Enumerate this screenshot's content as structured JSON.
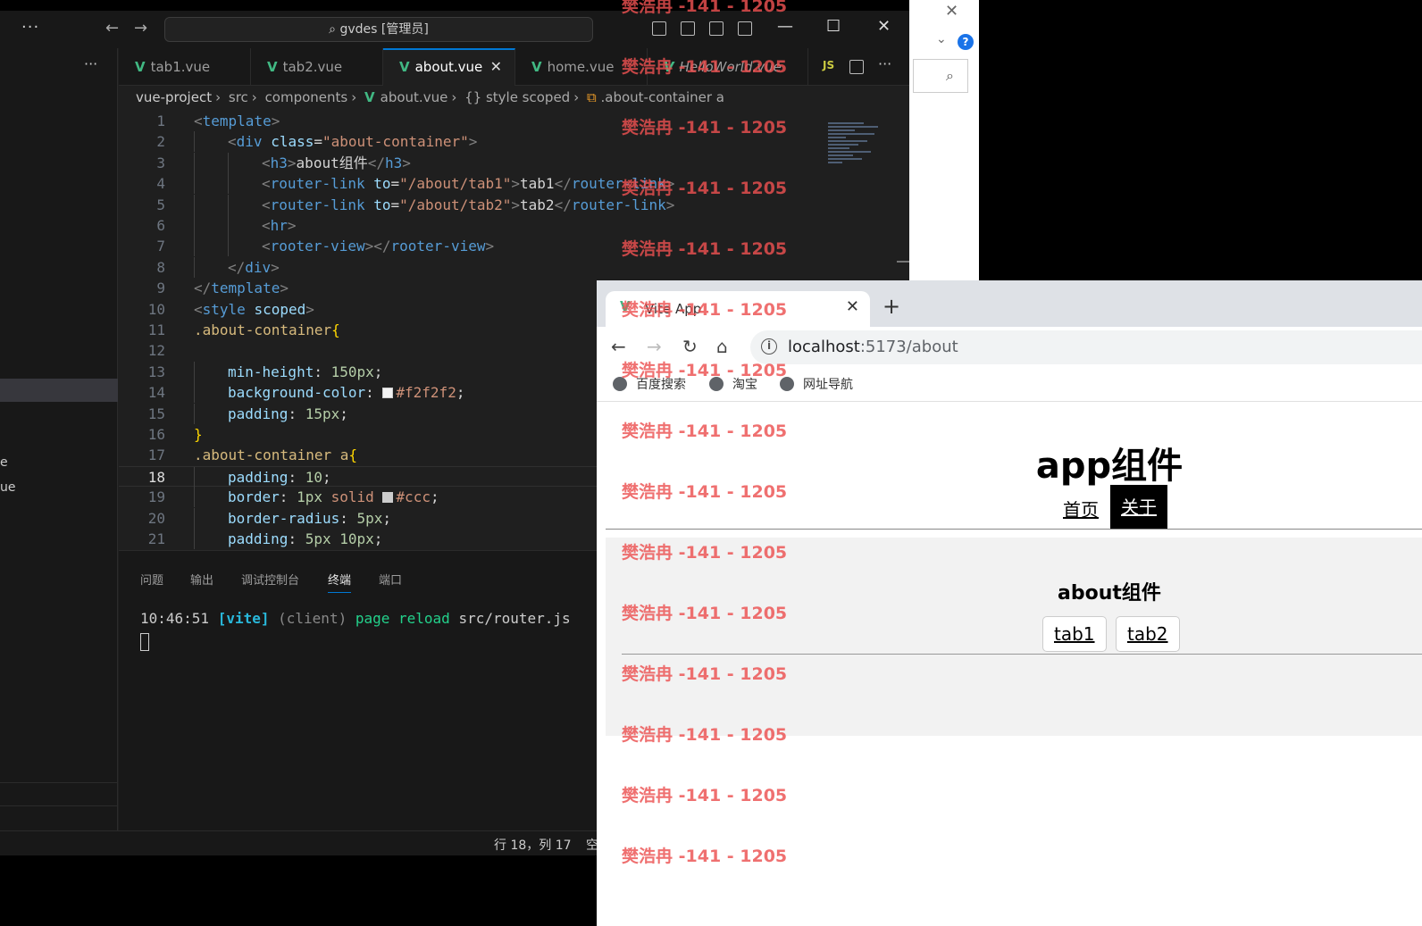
{
  "vscode": {
    "title_search": "gvdes [管理员]",
    "sidebar_fragments": [
      "e",
      "ue"
    ],
    "tabs": [
      {
        "label": "tab1.vue"
      },
      {
        "label": "tab2.vue"
      },
      {
        "label": "about.vue"
      },
      {
        "label": "home.vue"
      },
      {
        "label": "HelloWorld.vue"
      }
    ],
    "js_badge": "JS",
    "breadcrumb": [
      "vue-project",
      "src",
      "components",
      "about.vue",
      "{} style scoped",
      ".about-container a"
    ],
    "line_numbers": [
      "1",
      "2",
      "3",
      "4",
      "5",
      "6",
      "7",
      "8",
      "9",
      "10",
      "11",
      "12",
      "13",
      "14",
      "15",
      "16",
      "17",
      "18",
      "19",
      "20",
      "21"
    ],
    "code": {
      "l1": [
        "<",
        "template",
        ">"
      ],
      "l2": [
        "<",
        "div",
        " ",
        "class",
        "=",
        "\"about-container\"",
        ">"
      ],
      "l3": [
        "<",
        "h3",
        ">",
        "about组件",
        "</",
        "h3",
        ">"
      ],
      "l4": [
        "<",
        "router-link",
        " ",
        "to",
        "=",
        "\"/about/tab1\"",
        ">",
        "tab1",
        "</",
        "router-link",
        ">"
      ],
      "l5": [
        "<",
        "router-link",
        " ",
        "to",
        "=",
        "\"/about/tab2\"",
        ">",
        "tab2",
        "</",
        "router-link",
        ">"
      ],
      "l6": [
        "<",
        "hr",
        ">"
      ],
      "l7": [
        "<",
        "rooter-view",
        ">",
        "</",
        "rooter-view",
        ">"
      ],
      "l8": [
        "</",
        "div",
        ">"
      ],
      "l9": [
        "</",
        "template",
        ">"
      ],
      "l10": [
        "<",
        "style",
        " ",
        "scoped",
        ">"
      ],
      "l11": [
        ".about-container",
        "{"
      ],
      "l13": [
        "min-height",
        ": ",
        "150px",
        ";"
      ],
      "l14": [
        "background-color",
        ": ",
        "#f2f2f2",
        ";"
      ],
      "l15": [
        "padding",
        ": ",
        "15px",
        ";"
      ],
      "l16": [
        "}"
      ],
      "l17": [
        ".about-container a",
        "{"
      ],
      "l18": [
        "padding",
        ": ",
        "10",
        ";"
      ],
      "l19": [
        "border",
        ": ",
        "1px",
        " ",
        "solid",
        " ",
        "#ccc",
        ";"
      ],
      "l20": [
        "border-radius",
        ": ",
        "5px",
        ";"
      ],
      "l21": [
        "padding",
        ": ",
        "5px 10px",
        ";"
      ]
    },
    "panel_tabs": [
      "问题",
      "输出",
      "调试控制台",
      "终端",
      "端口"
    ],
    "terminal": {
      "time": "10:46:51",
      "tag": "[vite]",
      "client": "(client)",
      "msg": "page reload",
      "file": "src/router.js"
    },
    "status": {
      "position": "行 18，列 17",
      "spaces": "空"
    }
  },
  "browser": {
    "tab_title": "Vite App",
    "url_host": "localhost",
    "url_rest": ":5173/about",
    "bookmarks": [
      "百度搜索",
      "淘宝",
      "网址导航"
    ],
    "page": {
      "app_title": "app组件",
      "nav": [
        "首页",
        "关于"
      ],
      "about_title": "about组件",
      "tabs": [
        "tab1",
        "tab2"
      ]
    }
  },
  "watermark": "樊浩冉 -141 - 1205"
}
